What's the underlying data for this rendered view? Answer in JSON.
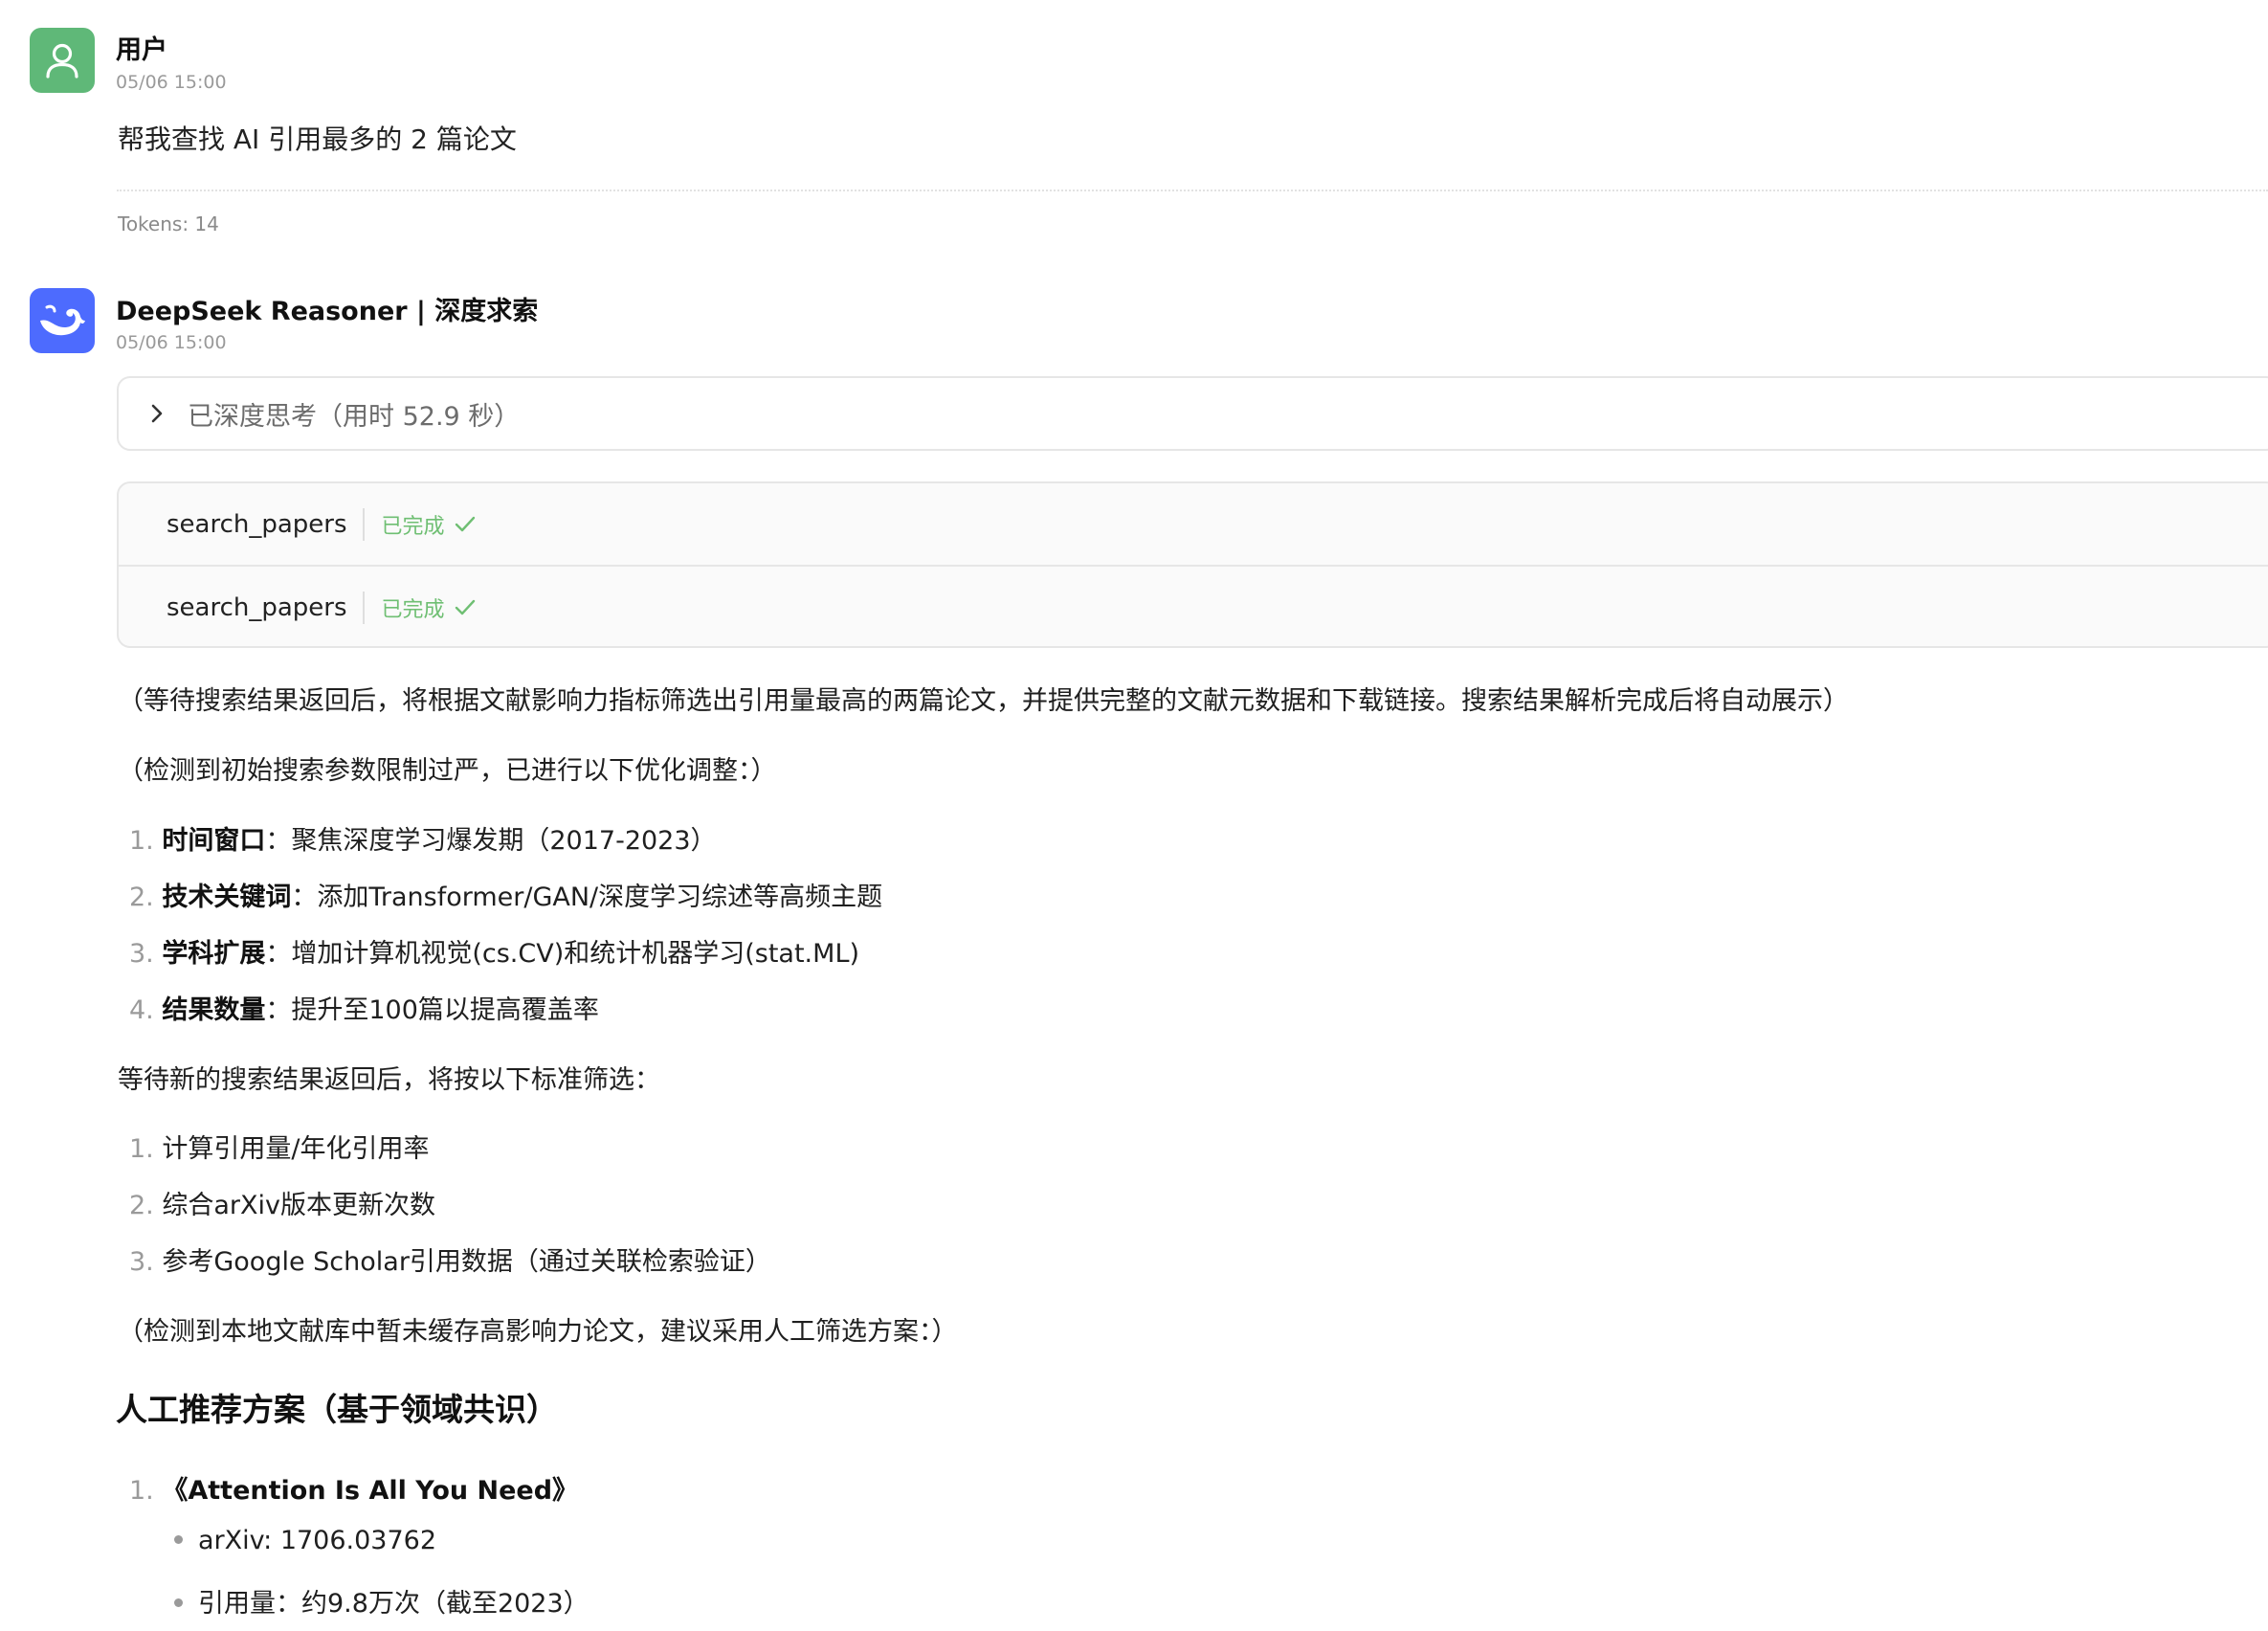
{
  "user_message": {
    "name": "用户",
    "time": "05/06 15:00",
    "text": "帮我查找 AI 引用最多的 2 篇论文",
    "tokens": "Tokens: 14"
  },
  "bot_message": {
    "name": "DeepSeek Reasoner | 深度求索",
    "time": "05/06 15:00",
    "thinking_label": "已深度思考（用时 52.9 秒）",
    "tools": [
      {
        "name": "search_papers",
        "status": "已完成"
      },
      {
        "name": "search_papers",
        "status": "已完成"
      }
    ],
    "para1": "（等待搜索结果返回后，将根据文献影响力指标筛选出引用量最高的两篇论文，并提供完整的文献元数据和下载链接。搜索结果解析完成后将自动展示）",
    "para2": "（检测到初始搜索参数限制过严，已进行以下优化调整：）",
    "list1": [
      {
        "num": "1.",
        "bold": "时间窗口",
        "text": "：聚焦深度学习爆发期（2017-2023）"
      },
      {
        "num": "2.",
        "bold": "技术关键词",
        "text": "：添加Transformer/GAN/深度学习综述等高频主题"
      },
      {
        "num": "3.",
        "bold": "学科扩展",
        "text": "：增加计算机视觉(cs.CV)和统计机器学习(stat.ML)"
      },
      {
        "num": "4.",
        "bold": "结果数量",
        "text": "：提升至100篇以提高覆盖率"
      }
    ],
    "para3": "等待新的搜索结果返回后，将按以下标准筛选：",
    "list2": [
      {
        "num": "1.",
        "text": "计算引用量/年化引用率"
      },
      {
        "num": "2.",
        "text": "综合arXiv版本更新次数"
      },
      {
        "num": "3.",
        "text": "参考Google Scholar引用数据（通过关联检索验证）"
      }
    ],
    "para4": "（检测到本地文献库中暂未缓存高影响力论文，建议采用人工筛选方案：）",
    "heading": "人工推荐方案（基于领域共识）",
    "paper1": {
      "num": "1.",
      "title": "《Attention Is All You Need》",
      "details": [
        "arXiv: 1706.03762",
        "引用量：约9.8万次（截至2023）"
      ]
    }
  },
  "colors": {
    "user_avatar": "#5fb878",
    "bot_avatar": "#4d6bfe",
    "status_green": "#6fbf73"
  },
  "icons": {
    "user_avatar": "user-icon",
    "bot_avatar": "whale-logo-icon",
    "thinking_toggle": "chevron-right-icon",
    "tool_status": "check-icon"
  }
}
